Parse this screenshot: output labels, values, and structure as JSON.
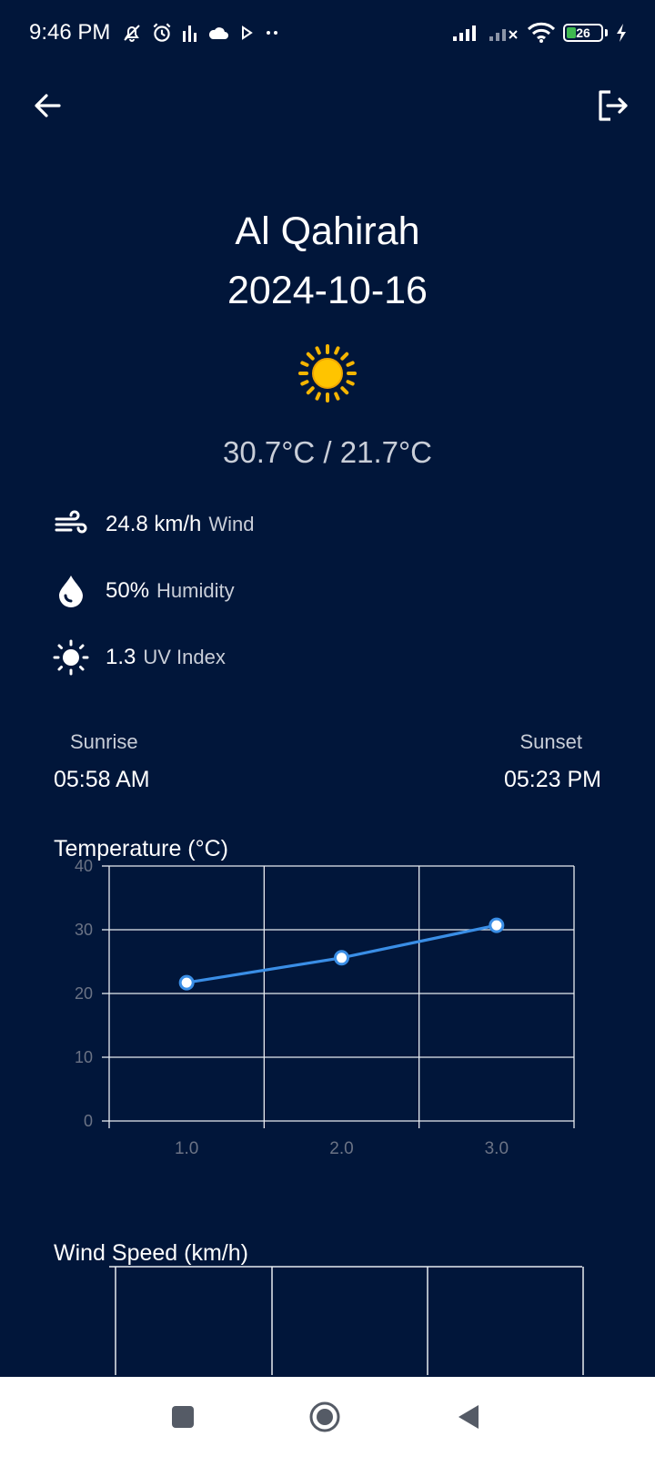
{
  "status_bar": {
    "time": "9:46 PM",
    "battery_level": "26",
    "icons": [
      "bell-off-icon",
      "alarm-icon",
      "equalizer-icon",
      "cloud-icon",
      "play-icon",
      "more-dots-icon",
      "signal-icon",
      "signal-x-icon",
      "wifi-icon",
      "battery-icon",
      "charging-icon"
    ]
  },
  "top_bar": {
    "back_icon": "arrow-left-icon",
    "logout_icon": "logout-icon"
  },
  "weather": {
    "city": "Al Qahirah",
    "date": "2024-10-16",
    "condition_icon": "sun-icon",
    "temperature_range": "30.7°C / 21.7°C",
    "wind_value": "24.8 km/h",
    "wind_label": "Wind",
    "humidity_value": "50%",
    "humidity_label": "Humidity",
    "uv_value": "1.3",
    "uv_label": "UV Index"
  },
  "sun": {
    "sunrise_label": "Sunrise",
    "sunrise_time": "05:58 AM",
    "sunset_label": "Sunset",
    "sunset_time": "05:23 PM"
  },
  "charts": {
    "temperature_title": "Temperature (°C)",
    "wind_title": "Wind Speed (km/h)"
  },
  "chart_data": [
    {
      "type": "line",
      "title": "Temperature (°C)",
      "x": [
        1.0,
        2.0,
        3.0
      ],
      "x_ticks": [
        "1.0",
        "2.0",
        "3.0"
      ],
      "xlim": [
        0.5,
        3.5
      ],
      "y_ticks": [
        "0",
        "10",
        "20",
        "30",
        "40"
      ],
      "ylim": [
        0,
        40
      ],
      "series": [
        {
          "values": [
            21.7,
            25.6,
            30.7
          ]
        }
      ],
      "colors": {
        "line": "#3a8ee6",
        "grid": "#e8ebf0",
        "tick_text": "#6b7385"
      },
      "grid": true
    },
    {
      "type": "line",
      "title": "Wind Speed (km/h)",
      "series": [],
      "grid": true
    }
  ],
  "nav_bar": {
    "icons": [
      "recents-square-icon",
      "home-circle-icon",
      "back-triangle-icon"
    ]
  }
}
